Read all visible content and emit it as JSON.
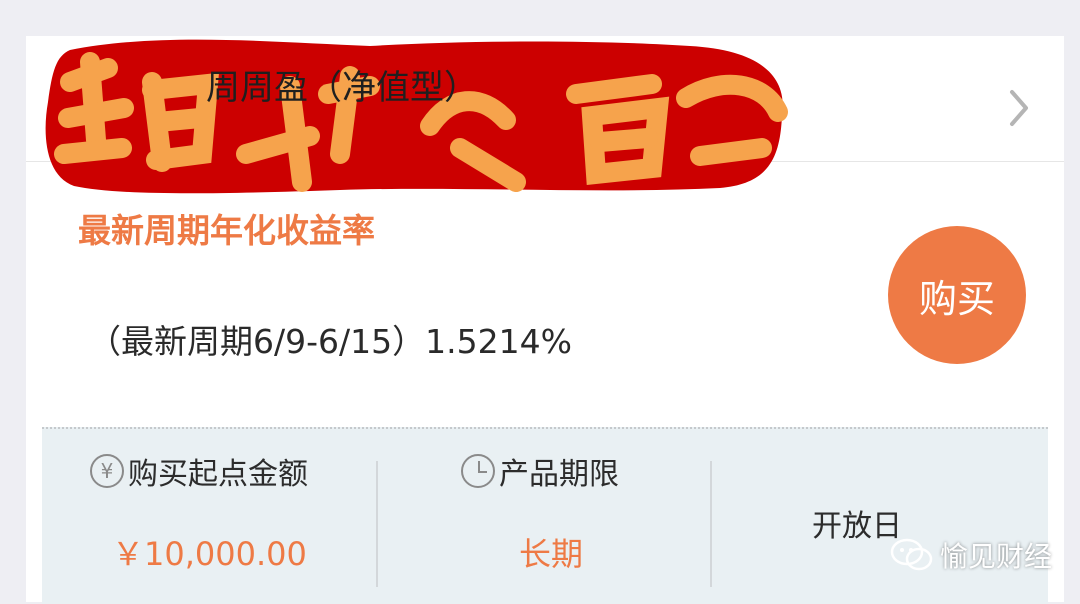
{
  "product": {
    "name": "周周盈（净值型）"
  },
  "yield": {
    "label": "最新周期年化收益率",
    "value": "（最新周期6/9-6/15）1.5214%"
  },
  "buy_button": {
    "label": "购买"
  },
  "info": {
    "min_amount": {
      "title": "购买起点金额",
      "value": "￥10,000.00",
      "icon": "yen-circle-icon"
    },
    "term": {
      "title": "产品期限",
      "value": "长期",
      "icon": "clock-icon"
    },
    "open_day": {
      "title": "开放日"
    }
  },
  "watermark": {
    "text": "愉见财经"
  },
  "colors": {
    "accent": "#ee7a45",
    "info_bg": "#e9f0f3",
    "scribble_red": "#cc0000",
    "scribble_orange": "#f6a34c"
  }
}
